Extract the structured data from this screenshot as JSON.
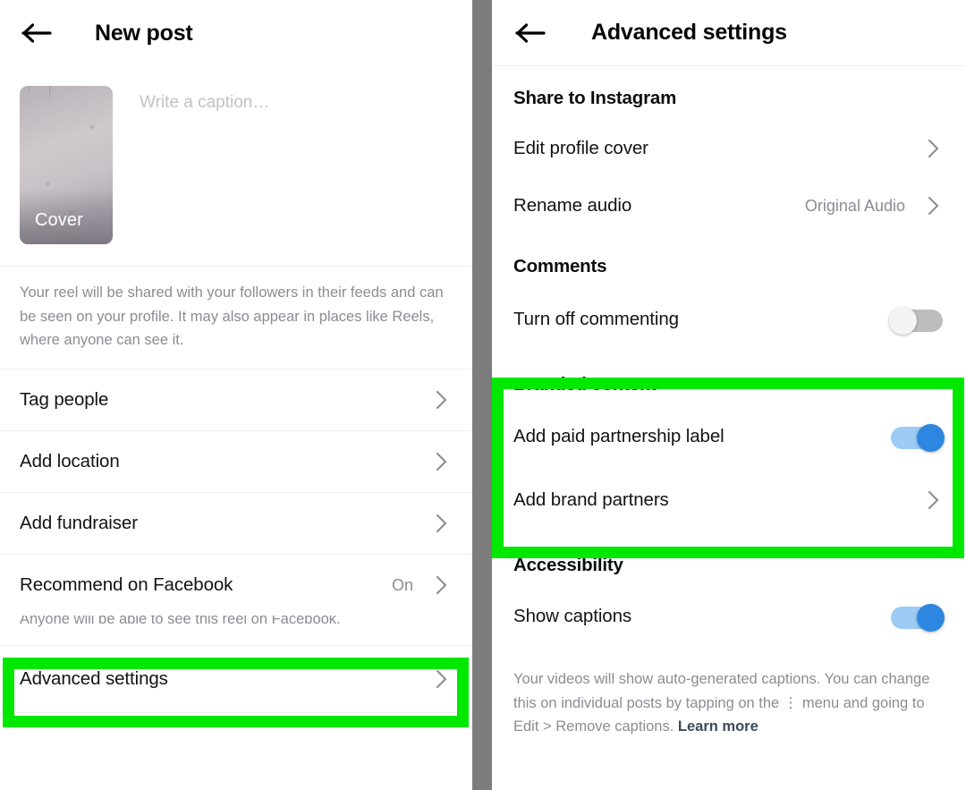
{
  "left_panel": {
    "back_icon": "back-arrow-icon",
    "title": "New post",
    "composer": {
      "cover_label": "Cover",
      "caption_placeholder": "Write a caption…"
    },
    "share_note": "Your reel will be shared with your followers in their feeds and can be seen on your profile. It may also appear in places like Reels, where anyone can see it.",
    "rows": [
      {
        "label": "Tag people",
        "value": "",
        "chevron": "chevron-right-icon"
      },
      {
        "label": "Add location",
        "value": "",
        "chevron": "chevron-right-icon"
      },
      {
        "label": "Add fundraiser",
        "value": "",
        "chevron": "chevron-right-icon"
      }
    ],
    "recommend_row": {
      "label": "Recommend on Facebook",
      "value": "On",
      "chevron": "chevron-right-icon",
      "subnote": "Anyone will be able to see this reel on Facebook."
    },
    "advanced_row": {
      "label": "Advanced settings",
      "chevron": "chevron-right-icon",
      "highlighted": true
    }
  },
  "right_panel": {
    "back_icon": "back-arrow-icon",
    "title": "Advanced settings",
    "sections": {
      "share": {
        "heading": "Share to Instagram",
        "rows": [
          {
            "label": "Edit profile cover",
            "value": "",
            "chevron": "chevron-right-icon"
          },
          {
            "label": "Rename audio",
            "value": "Original Audio",
            "chevron": "chevron-right-icon"
          }
        ]
      },
      "comments": {
        "heading": "Comments",
        "toggle_label": "Turn off commenting",
        "toggle_state": "off"
      },
      "branded": {
        "heading": "Branded content",
        "toggle_label": "Add paid partnership label",
        "toggle_state": "on",
        "partners_label": "Add brand partners",
        "partners_chevron": "chevron-right-icon",
        "highlighted": true
      },
      "accessibility": {
        "heading": "Accessibility",
        "toggle_label": "Show captions",
        "toggle_state": "on",
        "footnote_part1": "Your videos will show auto-generated captions. You can change this on individual posts by tapping on the",
        "footnote_dots": "⋮",
        "footnote_part2": "menu and going to Edit > Remove captions.",
        "learn_more": "Learn more"
      }
    }
  },
  "colors": {
    "highlight_green": "#00e800",
    "toggle_on_track": "#9ccbf5",
    "toggle_on_knob": "#2d87e0",
    "toggle_off_track": "#bdbdbd",
    "link": "#3c4a5a",
    "muted_text": "#8a8d91",
    "divider_gray": "#7c7c7c"
  }
}
